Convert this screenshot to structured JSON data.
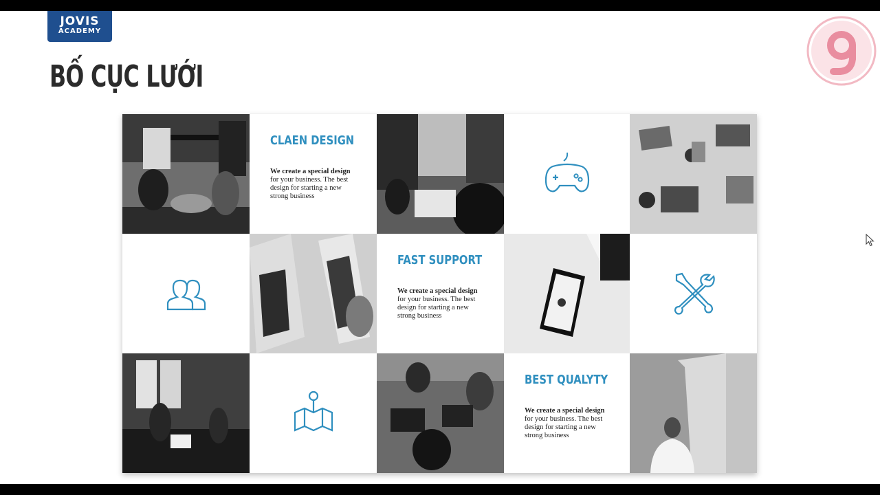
{
  "header": {
    "logo_line1": "JOVIS",
    "logo_line2": "ACADEMY",
    "title": "BỐ CỤC LƯỚI"
  },
  "grid": {
    "features": [
      {
        "heading": "CLAEN DESIGN",
        "body_bold": "We create a special design",
        "body_rest": "for your business. The best design for starting a new strong business"
      },
      {
        "heading": "FAST SUPPORT",
        "body_bold": "We create a special design",
        "body_rest": "for your business. The best design for starting a new strong business"
      },
      {
        "heading": "BEST QUALYTY",
        "body_bold": "We create a special design",
        "body_rest": "for your business. The best design for starting a new strong business"
      }
    ],
    "icons": [
      "gamepad-icon",
      "users-icon",
      "tools-icon",
      "map-pin-icon"
    ],
    "photos": [
      "office-meeting-photo",
      "team-laptops-photo",
      "desk-topdown-photo",
      "laptops-closeup-photo",
      "smartphone-photo",
      "home-office-photo",
      "coworking-photo",
      "speaker-photo"
    ]
  },
  "colors": {
    "accent": "#2f8fbf",
    "logo_bg": "#1f4f8f",
    "title": "#2b2b2b",
    "brand_mark": "#f0a8b4"
  }
}
